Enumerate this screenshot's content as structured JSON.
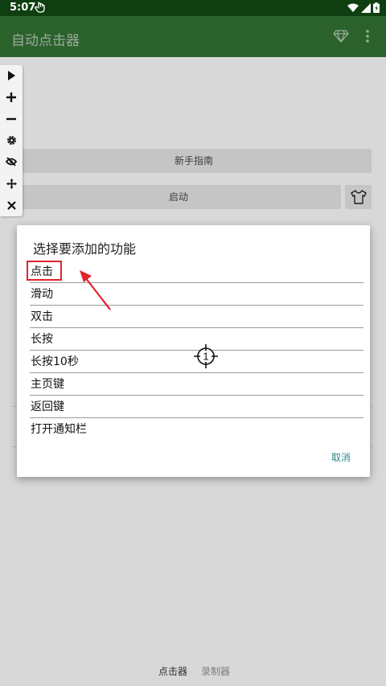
{
  "status_bar": {
    "time": "5:07"
  },
  "app_bar": {
    "title": "自动点击器"
  },
  "main": {
    "guide_button": "新手指南",
    "start_button": "启动"
  },
  "bottom_nav": {
    "clicker": "点击器",
    "recorder": "录制器"
  },
  "dialog": {
    "title": "选择要添加的功能",
    "options": [
      "点击",
      "滑动",
      "双击",
      "长按",
      "长按10秒",
      "主页键",
      "返回键",
      "打开通知栏"
    ],
    "cancel": "取消"
  },
  "crosshair": {
    "number": "1"
  },
  "colors": {
    "app_bar": "#2f6b30",
    "status_bar": "#0f3f10",
    "accent": "#2a8a86",
    "highlight": "#e2232a"
  },
  "icons": [
    "hand-icon",
    "wifi-icon",
    "signal-icon",
    "battery-icon",
    "diamond-icon",
    "more-icon",
    "play-icon",
    "plus-icon",
    "minus-icon",
    "gear-icon",
    "eye-off-icon",
    "move-icon",
    "close-icon",
    "shirt-icon",
    "crosshair-icon"
  ]
}
